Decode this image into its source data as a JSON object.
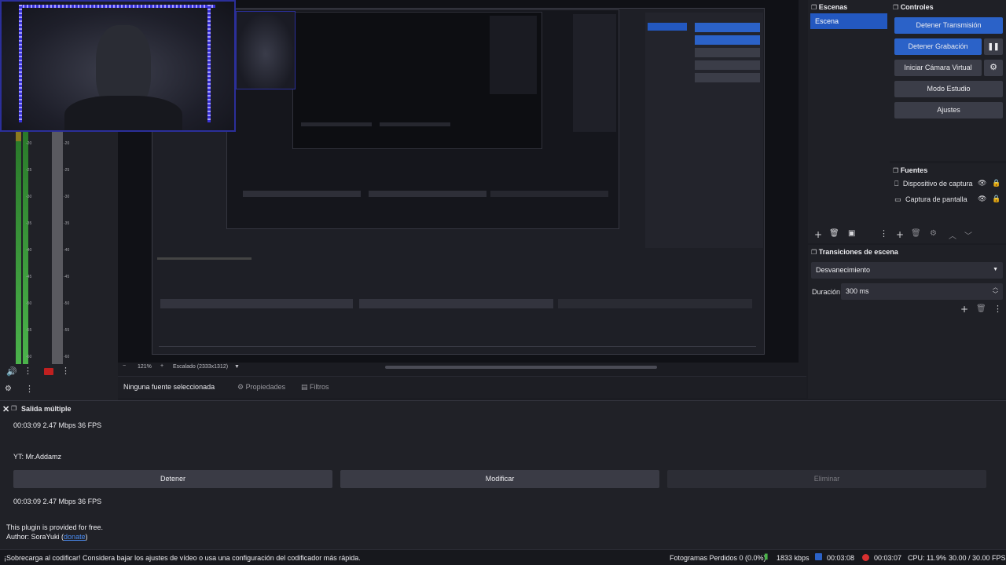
{
  "scenes": {
    "title": "Escenas",
    "items": [
      {
        "label": "Escena",
        "selected": true
      }
    ]
  },
  "controls": {
    "title": "Controles",
    "stop_stream": "Detener Transmisión",
    "stop_record": "Detener Grabación",
    "virtual_cam": "Iniciar Cámara Virtual",
    "studio_mode": "Modo Estudio",
    "settings": "Ajustes"
  },
  "sources": {
    "title": "Fuentes",
    "items": [
      {
        "label": "Dispositivo de captura"
      },
      {
        "label": "Captura de pantalla"
      }
    ]
  },
  "transitions": {
    "title": "Transiciones de escena",
    "selected": "Desvanecimiento",
    "duration_label": "Duración",
    "duration_value": "300 ms"
  },
  "preview": {
    "zoom": "121%",
    "scale_label": "Escalado (2333x1312)"
  },
  "source_bar": {
    "no_source": "Ninguna fuente seleccionada",
    "properties": "Propiedades",
    "filters": "Filtros"
  },
  "mixer_scale": [
    "-20",
    "-25",
    "-30",
    "-35",
    "-40",
    "-45",
    "-50",
    "-55",
    "-60"
  ],
  "multi_output": {
    "title": "Salida múltiple",
    "stats_1": "00:03:09  2.47 Mbps  36 FPS",
    "channel": "YT: Mr.Addamz",
    "stop": "Detener",
    "modify": "Modificar",
    "delete": "Eliminar",
    "stats_2": "00:03:09  2.47 Mbps  36 FPS",
    "free_note": "This plugin is provided for free.",
    "author_prefix": "Author: SoraYuki (",
    "author_link": "donate",
    "author_suffix": ")"
  },
  "status": {
    "warning": "¡Sobrecarga al codificar! Considera bajar los ajustes de vídeo o usa una configuración del codificador más rápida.",
    "dropped": "Fotogramas Perdidos 0 (0.0%)",
    "bitrate": "1833 kbps",
    "stream_time": "00:03:08",
    "rec_time": "00:03:07",
    "cpu": "CPU: 11.9%",
    "fps": "30.00 / 30.00 FPS"
  },
  "colors": {
    "accent": "#2b62c8",
    "meter_green": "#4bb34b",
    "record_red": "#d93030",
    "link": "#4a8bf0"
  }
}
